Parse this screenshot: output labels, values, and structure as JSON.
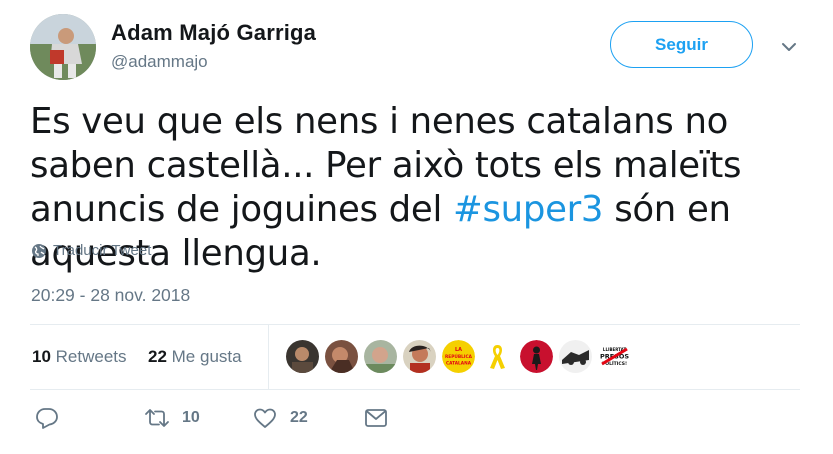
{
  "header": {
    "name": "Adam Majó Garriga",
    "handle": "@adammajo",
    "follow_label": "Seguir",
    "caret_icon": "chevron-down-icon"
  },
  "tweet": {
    "text_part1": "Es veu que els nens i nenes catalans no saben castellà... Per això tots els maleïts anuncis de joguines del ",
    "hashtag": "#super3",
    "text_part2": " són en aquesta llengua.",
    "translate_label": "Traducir Tweet",
    "timestamp": "20:29 - 28 nov. 2018"
  },
  "stats": {
    "retweets_count": "10",
    "retweets_label": " Retweets",
    "likes_count": "22",
    "likes_label": " Me gusta",
    "liker_avatars": [
      "avatar-1",
      "avatar-2",
      "avatar-3",
      "avatar-4",
      "la-republica-catalana-badge",
      "yellow-ribbon-icon",
      "avatar-7",
      "avatar-8",
      "llibertat-presos-politics-badge"
    ],
    "badge_text": "LA REPÚBLICA CATALANA",
    "badge2_text": "LLIBERTAT PRESOS POLÍTICS!"
  },
  "actions": {
    "reply_icon": "reply-icon",
    "retweet_icon": "retweet-icon",
    "retweet_count": "10",
    "like_icon": "heart-icon",
    "like_count": "22",
    "dm_icon": "envelope-icon"
  },
  "colors": {
    "accent": "#1da1f2",
    "hashtag": "#1b95e0",
    "secondary_text": "#657786",
    "primary_text": "#14171a",
    "divider": "#e6ecf0",
    "ribbon": "#f5d000",
    "badge_red": "#e30613"
  }
}
